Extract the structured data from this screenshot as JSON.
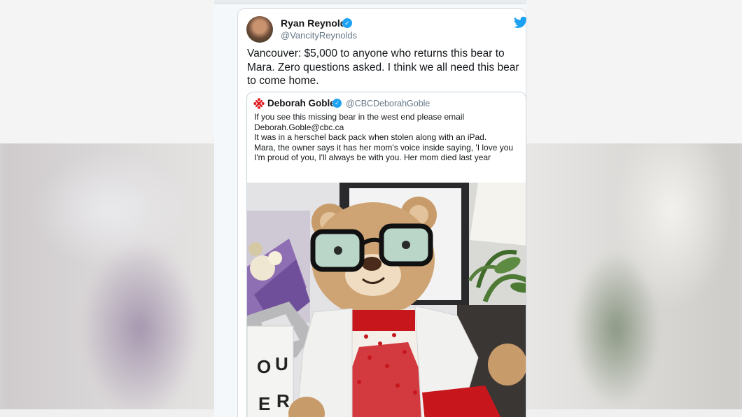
{
  "tweet": {
    "author_name": "Ryan Reynolds",
    "author_handle": "@VancityReynolds",
    "verified_icon": "verified-badge-icon",
    "brand_icon": "twitter-bird-icon",
    "text": "Vancouver: $5,000 to anyone who returns this bear to Mara. Zero questions asked. I think we all need this bear to come home."
  },
  "quoted_tweet": {
    "icon": "cbc-gem-icon",
    "author_name": "Deborah Goble",
    "author_handle": "@CBCDeborahGoble",
    "lines": [
      "If you see this missing bear in the west end please email",
      "Deborah.Goble@cbc.ca",
      "It was in a herschel back pack when stolen along with an iPad.",
      "Mara, the owner says it has her mom's voice inside saying, 'I love you I'm proud of you, I'll always be with you. Her mom died last year"
    ],
    "photo": {
      "letter_blocks": [
        "O",
        "U",
        "E",
        "R"
      ]
    }
  },
  "colors": {
    "twitter_blue": "#1da1f2",
    "cbc_red": "#e21e26",
    "dress_red": "#c8161d"
  }
}
